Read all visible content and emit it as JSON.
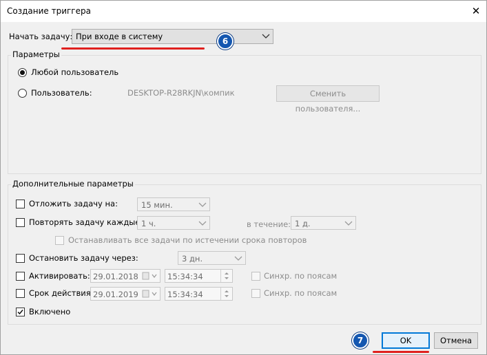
{
  "window": {
    "title": "Создание триггера",
    "close_glyph": "✕"
  },
  "start_task": {
    "label": "Начать задачу:",
    "value": "При входе в систему"
  },
  "params_group": {
    "legend": "Параметры",
    "any_user_label": "Любой пользователь",
    "user_label": "Пользователь:",
    "user_value": "DESKTOP-R28RKJN\\компик",
    "change_user_button": "Сменить пользователя...",
    "selected": "any_user"
  },
  "advanced_group": {
    "legend": "Дополнительные параметры",
    "delay": {
      "label": "Отложить задачу на:",
      "value": "15 мин.",
      "checked": false
    },
    "repeat": {
      "label": "Повторять задачу каждые:",
      "value": "1 ч.",
      "duration_label": "в течение:",
      "duration_value": "1 д.",
      "checked": false
    },
    "stop_all": {
      "label": "Останавливать все задачи по истечении срока повторов",
      "checked": false
    },
    "stop_after": {
      "label": "Остановить задачу через:",
      "value": "3 дн.",
      "checked": false
    },
    "activate": {
      "label": "Активировать:",
      "date": "29.01.2018",
      "time": "15:34:34",
      "sync_label": "Синхр. по поясам",
      "checked": false
    },
    "expire": {
      "label": "Срок действия:",
      "date": "29.01.2019",
      "time": "15:34:34",
      "sync_label": "Синхр. по поясам",
      "checked": false
    },
    "enabled": {
      "label": "Включено",
      "checked": true
    }
  },
  "buttons": {
    "ok": "OK",
    "cancel": "Отмена"
  },
  "annotations": {
    "badge_6": "6",
    "badge_7": "7"
  },
  "colors": {
    "badge": "#1457b0",
    "underline": "#e0201e"
  }
}
